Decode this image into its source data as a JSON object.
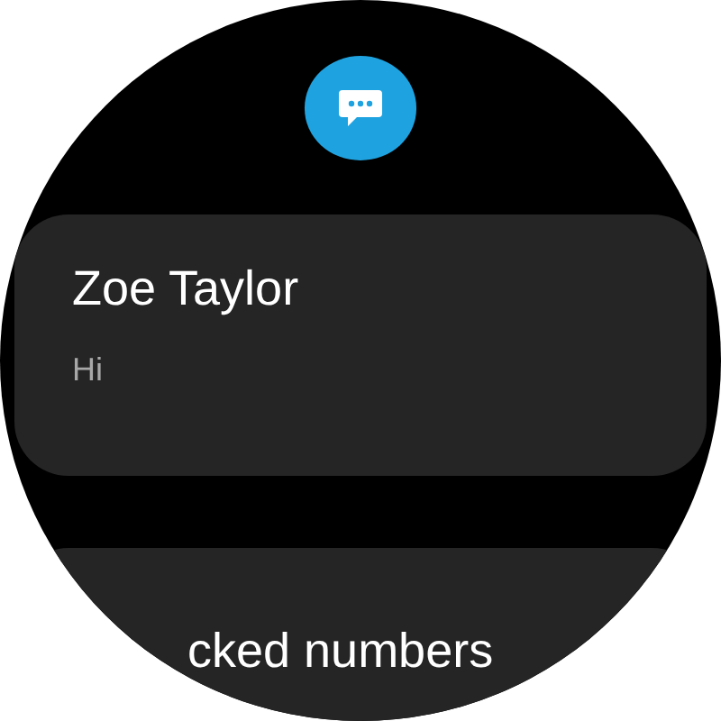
{
  "app_icon": {
    "kind": "messages"
  },
  "conversations": [
    {
      "name": "Zoe Taylor",
      "preview": "Hi"
    }
  ],
  "next_item": {
    "label": "cked numbers"
  }
}
